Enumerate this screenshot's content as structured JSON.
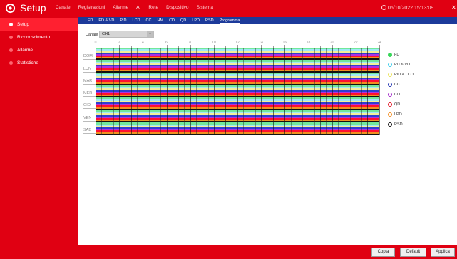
{
  "header": {
    "app_title": "Setup",
    "nav": [
      "Canale",
      "Registrazioni",
      "Allarme",
      "AI",
      "Rete",
      "Dispositivo",
      "Sistema"
    ],
    "active_nav_index": 3,
    "datetime": "06/10/2022 15:13:09"
  },
  "sidebar": {
    "items": [
      {
        "label": "Setup",
        "active": true
      },
      {
        "label": "Riconoscimento",
        "active": false
      },
      {
        "label": "Allarme",
        "active": false
      },
      {
        "label": "Statistiche",
        "active": false
      }
    ]
  },
  "subtabs": {
    "items": [
      "FD",
      "PD & VD",
      "PID",
      "LCD",
      "CC",
      "HM",
      "CD",
      "QD",
      "LPD",
      "RSD",
      "Programma"
    ],
    "active_index": 10
  },
  "channel": {
    "label": "Canale",
    "value": "CH1"
  },
  "schedule": {
    "hours": [
      "0",
      "2",
      "4",
      "6",
      "8",
      "10",
      "12",
      "14",
      "16",
      "18",
      "20",
      "22",
      "24"
    ],
    "days": [
      "DOM",
      "LUN",
      "MAR",
      "MER",
      "GIO",
      "VEN",
      "SAB"
    ]
  },
  "legend": [
    {
      "label": "FD",
      "color": "#39d65a",
      "filled": true,
      "band": "#72e89a"
    },
    {
      "label": "PD & VD",
      "color": "#30c8e8",
      "filled": false,
      "band": "#9fe9f7"
    },
    {
      "label": "PID & LCD",
      "color": "#e8e04a",
      "filled": false,
      "band": "#f3f09a"
    },
    {
      "label": "CC",
      "color": "#1c2fb0",
      "filled": false,
      "band": "#2f3fd0"
    },
    {
      "label": "CD",
      "color": "#a020c8",
      "filled": false,
      "band": "#b030e0"
    },
    {
      "label": "QD",
      "color": "#e01020",
      "filled": false,
      "band": "#ff1030"
    },
    {
      "label": "LPD",
      "color": "#f08a1a",
      "filled": false,
      "band": "#f09020"
    },
    {
      "label": "RSD",
      "color": "#111111",
      "filled": false,
      "band": "#111111"
    }
  ],
  "buttons": {
    "copy": "Copia",
    "default": "Default",
    "apply": "Applica"
  }
}
